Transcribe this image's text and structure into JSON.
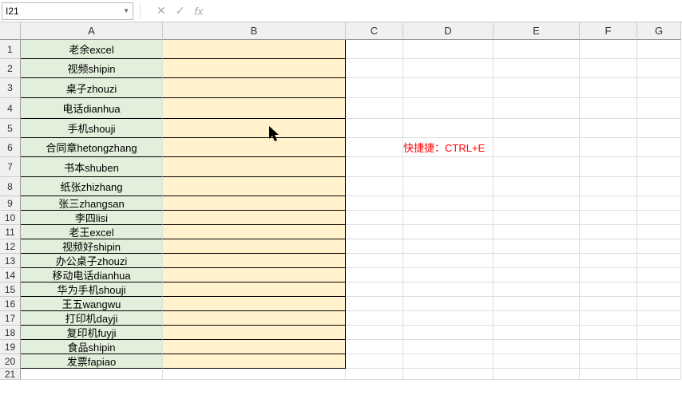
{
  "formula_bar": {
    "cell_ref": "I21",
    "formula": ""
  },
  "columns": [
    "A",
    "B",
    "C",
    "D",
    "E",
    "F",
    "G"
  ],
  "row_numbers": [
    "1",
    "2",
    "3",
    "4",
    "5",
    "6",
    "7",
    "8",
    "9",
    "10",
    "11",
    "12",
    "13",
    "14",
    "15",
    "16",
    "17",
    "18",
    "19",
    "20",
    "21"
  ],
  "col_a": [
    "老余excel",
    "视频shipin",
    "桌子zhouzi",
    "电话dianhua",
    "手机shouji",
    "合同章hetongzhang",
    "书本shuben",
    "纸张zhizhang",
    "张三zhangsan",
    "李四lisi",
    "老王excel",
    "视频好shipin",
    "办公桌子zhouzi",
    "移动电话dianhua",
    "华为手机shouji",
    "王五wangwu",
    "打印机dayji",
    "复印机fuyji",
    "食品shipin",
    "发票fapiao"
  ],
  "note": "快捷捷：CTRL+E"
}
